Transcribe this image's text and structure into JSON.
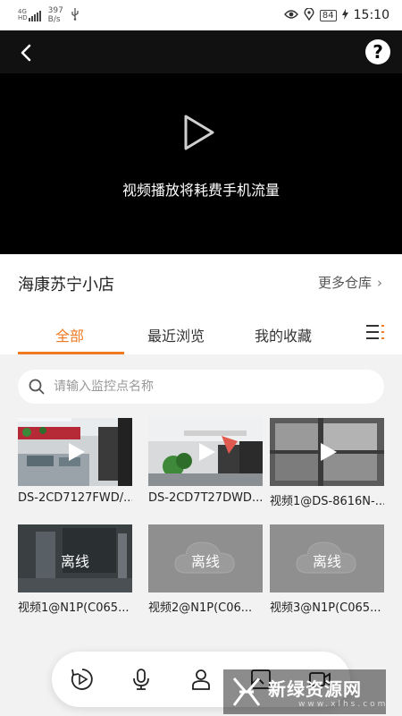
{
  "status_bar": {
    "network": "4G",
    "network_sub": "HD",
    "speed_value": "397",
    "speed_unit": "B/s",
    "usb_icon": "usb-icon",
    "battery": "84",
    "time": "15:10"
  },
  "video": {
    "back_icon": "chevron-left-icon",
    "help_label": "?",
    "play_icon": "play-icon",
    "message": "视频播放将耗费手机流量"
  },
  "store": {
    "name": "海康苏宁小店",
    "more_label": "更多仓库",
    "more_chevron": "›"
  },
  "tabs": {
    "items": [
      {
        "label": "全部",
        "active": true
      },
      {
        "label": "最近浏览",
        "active": false
      },
      {
        "label": "我的收藏",
        "active": false
      }
    ],
    "menu_icon": "list-menu-icon"
  },
  "search": {
    "placeholder": "请输入监控点名称",
    "icon": "search-icon"
  },
  "cameras": [
    {
      "label": "DS-2CD7127FWD/...",
      "status": "online"
    },
    {
      "label": "DS-2CD7T27DWD...",
      "status": "online"
    },
    {
      "label": "视频1@DS-8616N-...",
      "status": "online"
    },
    {
      "label": "视频1@N1P(C065...",
      "status": "offline",
      "overlay": "离线"
    },
    {
      "label": "视频2@N1P(C06...",
      "status": "offline",
      "overlay": "离线"
    },
    {
      "label": "视频3@N1P(C065...",
      "status": "offline",
      "overlay": "离线"
    }
  ],
  "bottom_bar": {
    "icons": [
      "playback-icon",
      "microphone-icon",
      "person-icon",
      "image-icon",
      "video-icon"
    ]
  },
  "watermark": {
    "text": "新绿资源网",
    "sub": "www.xlhs.com"
  },
  "colors": {
    "accent": "#ef7a22",
    "video_bg": "#000000",
    "page_bg": "#f2f2f2"
  }
}
